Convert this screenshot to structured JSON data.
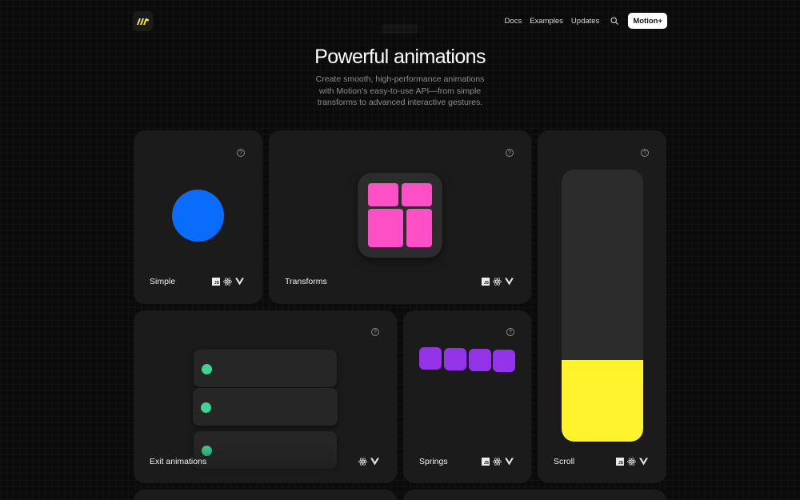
{
  "header": {
    "logo_icon": "motion-logo-icon",
    "nav": [
      {
        "label": "Docs"
      },
      {
        "label": "Examples"
      },
      {
        "label": "Updates"
      }
    ],
    "search_icon": "search-icon",
    "cta_label": "Motion+"
  },
  "hero": {
    "title": "Powerful animations",
    "subtitle": "Create smooth, high-performance animations with Motion’s easy-to-use API—from simple transforms to advanced interactive gestures."
  },
  "cards": {
    "simple": {
      "label": "Simple",
      "frameworks": [
        "js",
        "react",
        "vue"
      ]
    },
    "transforms": {
      "label": "Transforms",
      "frameworks": [
        "js",
        "react",
        "vue"
      ]
    },
    "scroll": {
      "label": "Scroll",
      "frameworks": [
        "js",
        "react",
        "vue"
      ],
      "progress": 0.3
    },
    "exit": {
      "label": "Exit animations",
      "frameworks": [
        "react",
        "vue"
      ]
    },
    "springs": {
      "label": "Springs",
      "frameworks": [
        "js",
        "react",
        "vue"
      ]
    }
  },
  "colors": {
    "circle": "#0a6cfc",
    "transform": "#ff4fc7",
    "scroll_fill": "#fff32e",
    "exit_dot": "#3cd595",
    "spring": "#9334ea"
  }
}
